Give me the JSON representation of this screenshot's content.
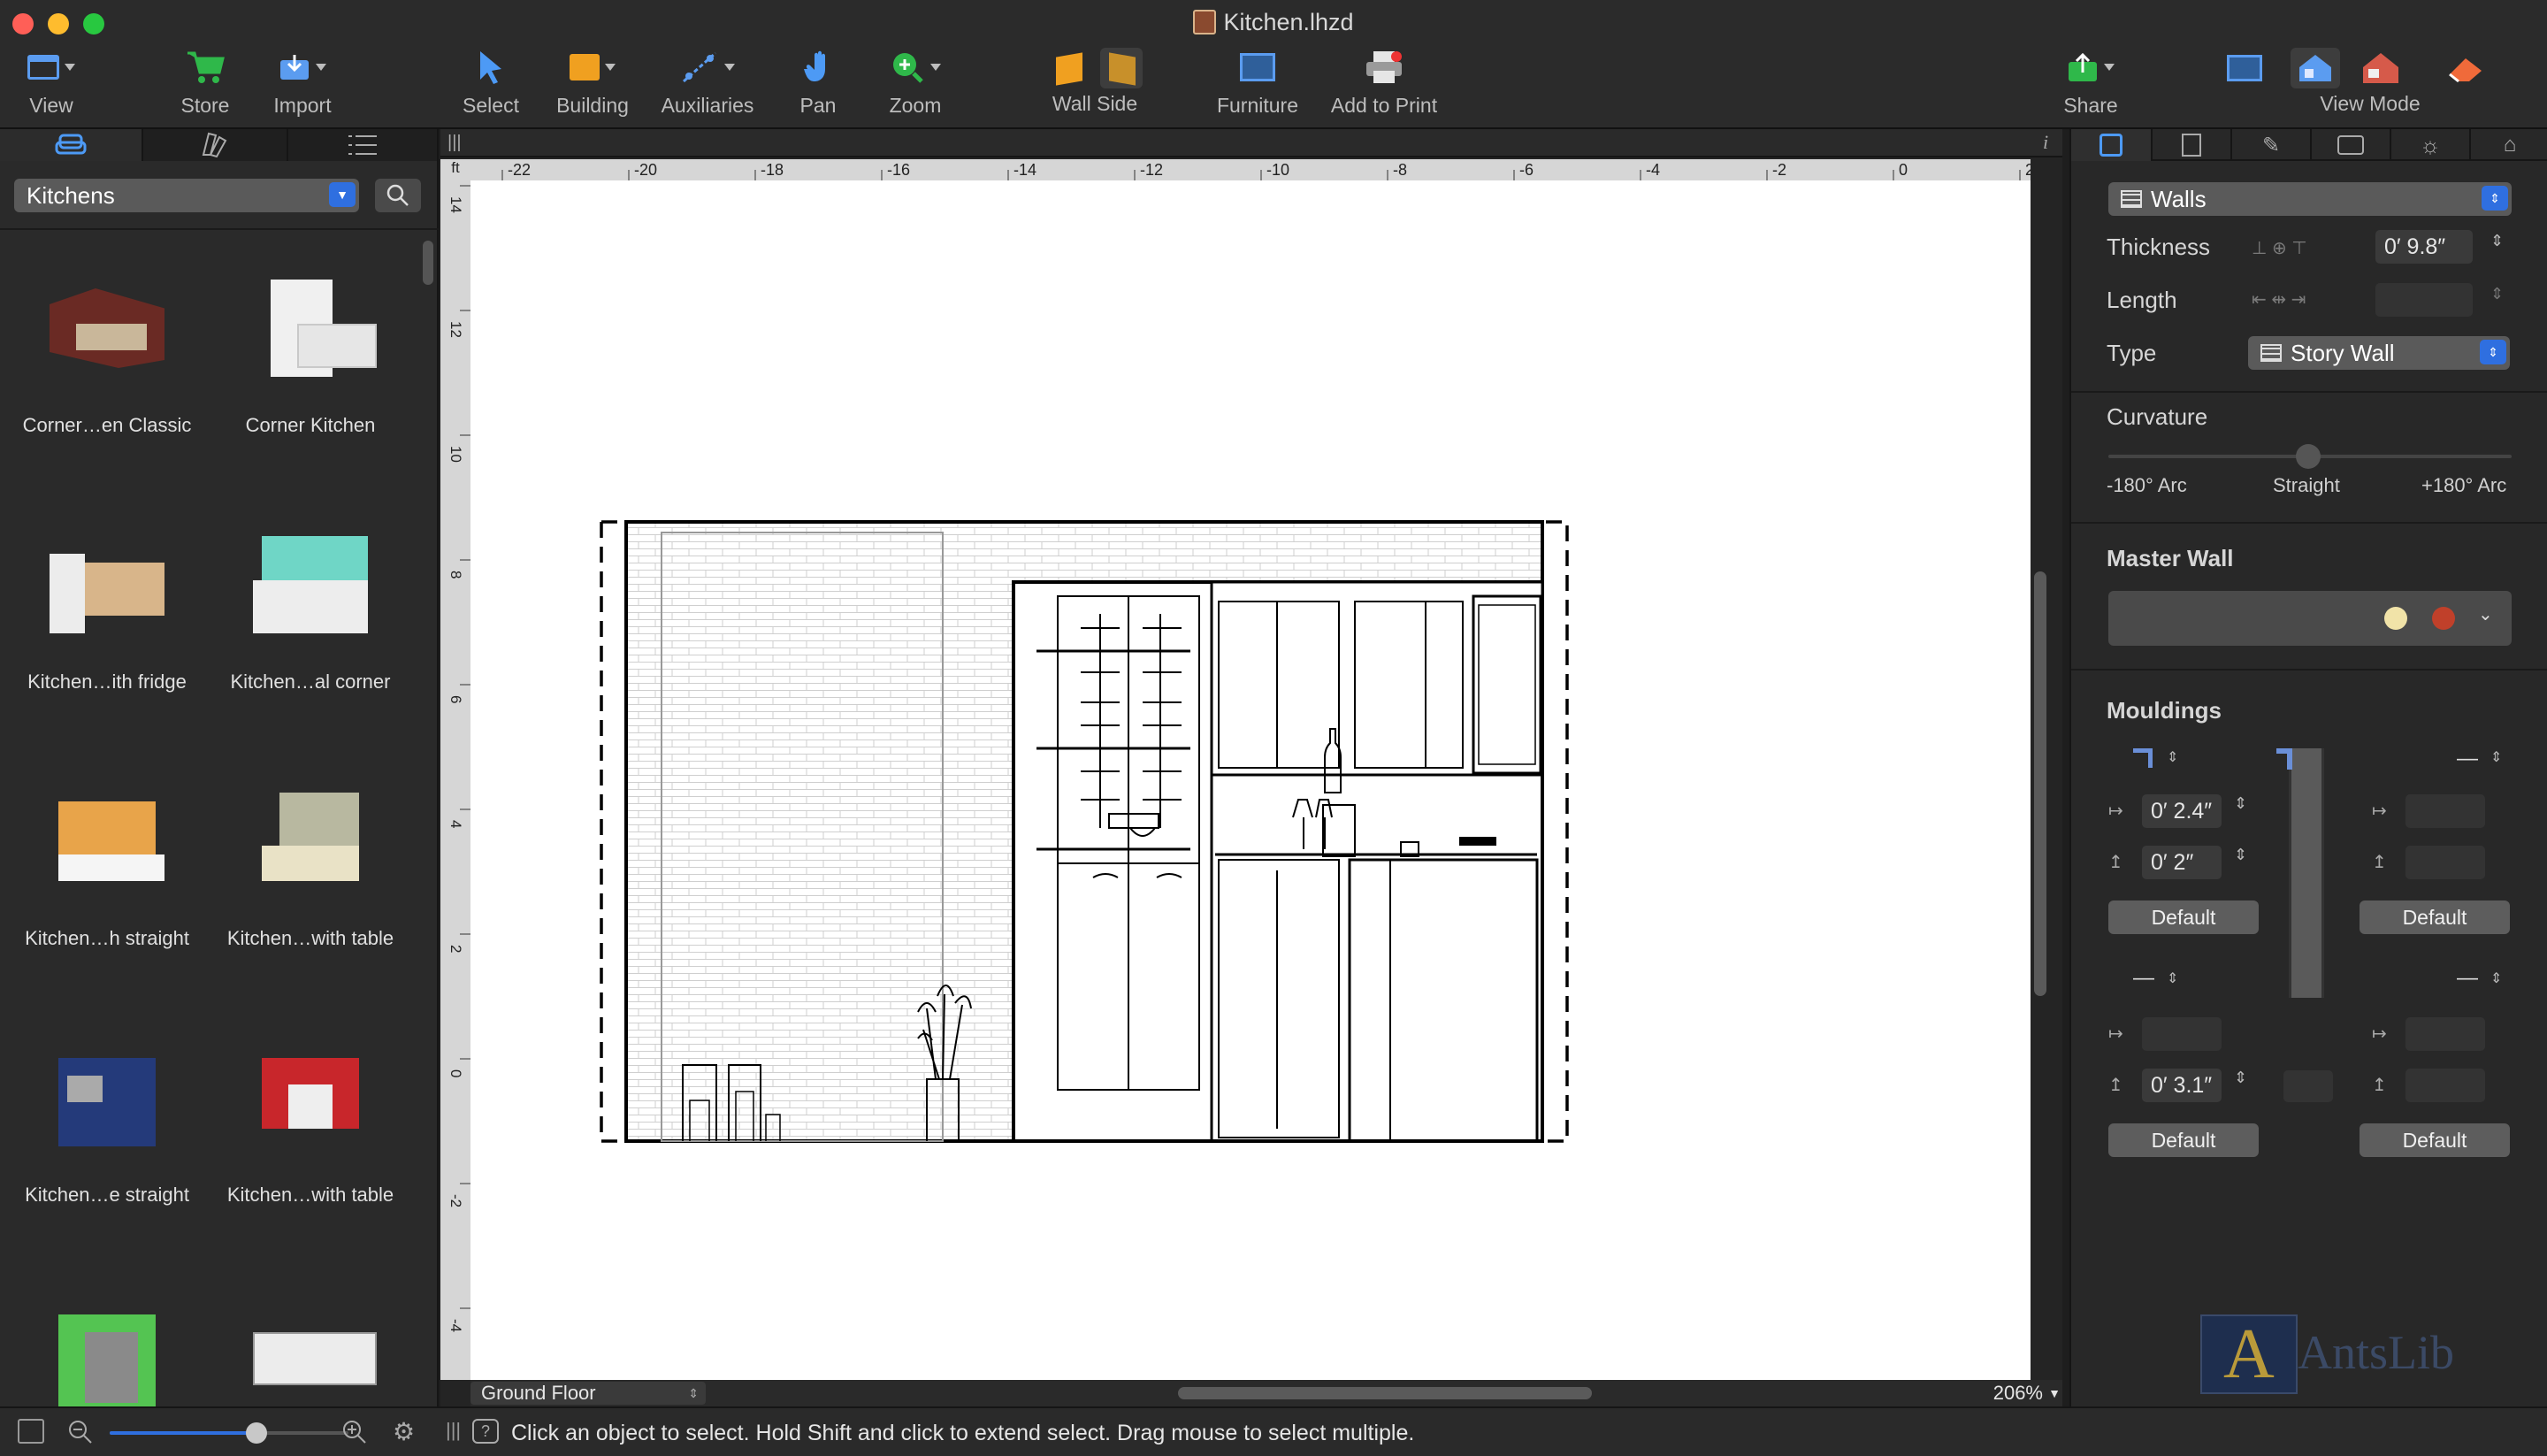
{
  "window": {
    "title": "Kitchen.lhzd"
  },
  "toolbar": {
    "view": "View",
    "store": "Store",
    "import": "Import",
    "select": "Select",
    "building": "Building",
    "auxiliaries": "Auxiliaries",
    "pan": "Pan",
    "zoom": "Zoom",
    "wall_side": "Wall Side",
    "furniture": "Furniture",
    "add_to_print": "Add to Print",
    "share": "Share",
    "view_mode": "View Mode"
  },
  "library": {
    "category": "Kitchens",
    "items": [
      {
        "label": "Corner…en Classic"
      },
      {
        "label": "Corner Kitchen"
      },
      {
        "label": "Kitchen…ith fridge"
      },
      {
        "label": "Kitchen…al corner"
      },
      {
        "label": "Kitchen…h straight"
      },
      {
        "label": "Kitchen…with table"
      },
      {
        "label": "Kitchen…e straight"
      },
      {
        "label": "Kitchen…with table"
      }
    ]
  },
  "ruler": {
    "unit": "ft",
    "h_ticks": [
      "-22",
      "-20",
      "-18",
      "-16",
      "-14",
      "-12",
      "-10",
      "-8",
      "-6",
      "-4",
      "-2",
      "0",
      "2"
    ],
    "v_ticks": [
      "14",
      "12",
      "10",
      "8",
      "6",
      "4",
      "2",
      "0",
      "-2",
      "-4"
    ]
  },
  "canvas": {
    "floor": "Ground Floor",
    "zoom": "206%"
  },
  "inspector": {
    "object_type": "Walls",
    "thickness_label": "Thickness",
    "thickness_value": "0′ 9.8″",
    "length_label": "Length",
    "length_value": "",
    "type_label": "Type",
    "type_value": "Story Wall",
    "curvature_label": "Curvature",
    "curv_min": "-180° Arc",
    "curv_mid": "Straight",
    "curv_max": "+180° Arc",
    "master_wall_label": "Master Wall",
    "mouldings_label": "Mouldings",
    "m_top_left_w": "0′ 2.4″",
    "m_top_left_h": "0′ 2″",
    "m_bot_left_w": "",
    "m_bot_left_h": "0′ 3.1″",
    "default": "Default"
  },
  "status": {
    "hint": "Click an object to select. Hold Shift and click to extend select. Drag mouse to select multiple."
  },
  "watermark": "AntsLib",
  "colors": {
    "accent": "#2f6fe0",
    "traffic_red": "#ff5f57",
    "traffic_yellow": "#febc2e",
    "traffic_green": "#28c840"
  }
}
